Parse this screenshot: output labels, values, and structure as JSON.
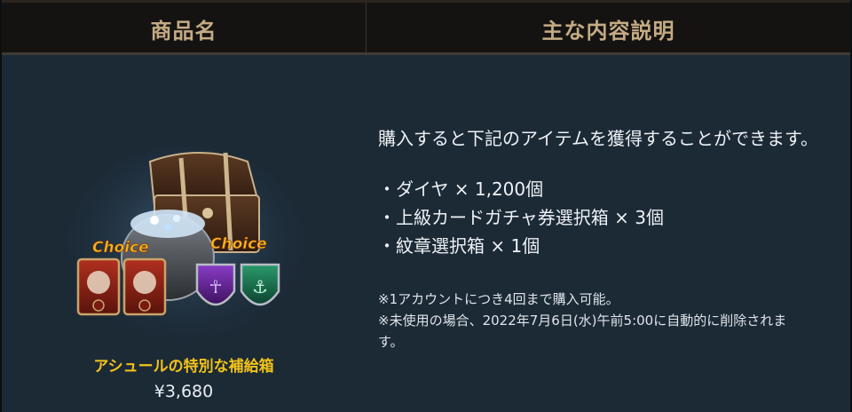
{
  "header": {
    "col_product": "商品名",
    "col_description": "主な内容説明"
  },
  "product": {
    "name": "アシュールの特別な補給箱",
    "price": "¥3,680",
    "choice_label": "Choice",
    "choice_label_2": "Choice",
    "icons": [
      "treasure-chest-icon",
      "diamond-pouch-icon",
      "red-card-icon",
      "crest-shield-icon"
    ]
  },
  "description": {
    "intro": "購入すると下記のアイテムを獲得することができます。",
    "items": [
      "・ダイヤ × 1,200個",
      "・上級カードガチャ券選択箱 × 3個",
      "・紋章選択箱 × 1個"
    ],
    "note_1": "※1アカウントにつき4回まで購入可能。",
    "note_2": "※未使用の場合、2022年7月6日(水)午前5:00に自動的に削除されま",
    "note_3": "す。"
  },
  "colors": {
    "background": "#1c2a36",
    "header_bg": "#151311",
    "header_text": "#c4ab84",
    "product_name": "#f1c21a",
    "choice_text": "#f2b51c"
  }
}
